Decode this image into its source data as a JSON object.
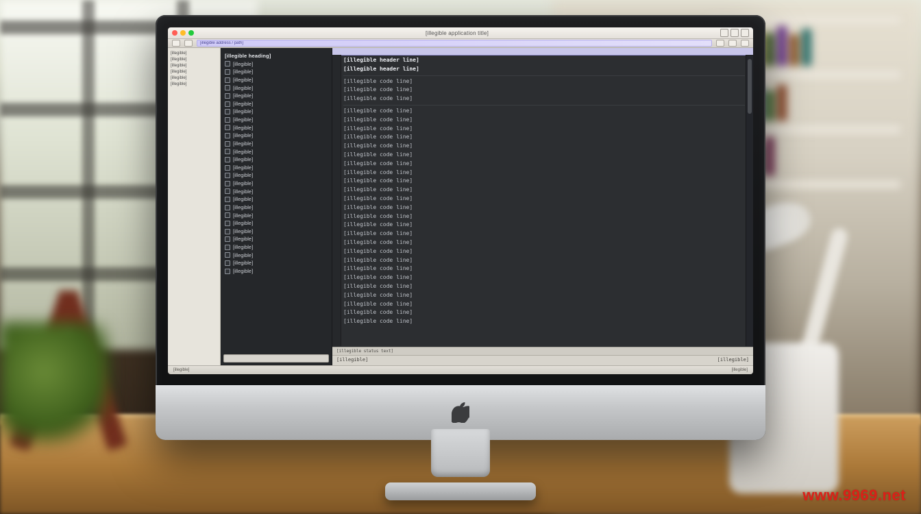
{
  "watermark": "www.9969.net",
  "window": {
    "title": "[illegible application title]"
  },
  "urlbar": {
    "value": "[illegible address / path]"
  },
  "side_narrow": {
    "items": [
      "[illegible]",
      "[illegible]",
      "[illegible]",
      "[illegible]",
      "[illegible]",
      "[illegible]"
    ]
  },
  "file_panel": {
    "heading": "[illegible heading]",
    "items": [
      "[illegible]",
      "[illegible]",
      "[illegible]",
      "[illegible]",
      "[illegible]",
      "[illegible]",
      "[illegible]",
      "[illegible]",
      "[illegible]",
      "[illegible]",
      "[illegible]",
      "[illegible]",
      "[illegible]",
      "[illegible]",
      "[illegible]",
      "[illegible]",
      "[illegible]",
      "[illegible]",
      "[illegible]",
      "[illegible]",
      "[illegible]",
      "[illegible]",
      "[illegible]",
      "[illegible]",
      "[illegible]",
      "[illegible]",
      "[illegible]"
    ]
  },
  "editor": {
    "header_line_1": "[illegible header line]",
    "header_line_2": "[illegible header line]",
    "lines": [
      "[illegible code line]",
      "[illegible code line]",
      "[illegible code line]",
      "[illegible code line]",
      "[illegible code line]",
      "[illegible code line]",
      "[illegible code line]",
      "[illegible code line]",
      "[illegible code line]",
      "[illegible code line]",
      "[illegible code line]",
      "[illegible code line]",
      "[illegible code line]",
      "[illegible code line]",
      "[illegible code line]",
      "[illegible code line]",
      "[illegible code line]",
      "[illegible code line]",
      "[illegible code line]",
      "[illegible code line]",
      "[illegible code line]",
      "[illegible code line]",
      "[illegible code line]",
      "[illegible code line]",
      "[illegible code line]",
      "[illegible code line]",
      "[illegible code line]",
      "[illegible code line]"
    ],
    "section_break_after": 3,
    "footer1": "[illegible status text]",
    "footer2_left": "[illegible]",
    "footer2_right": "[illegible]"
  },
  "os_strip": {
    "left": "[illegible]",
    "right": "[illegible]"
  }
}
